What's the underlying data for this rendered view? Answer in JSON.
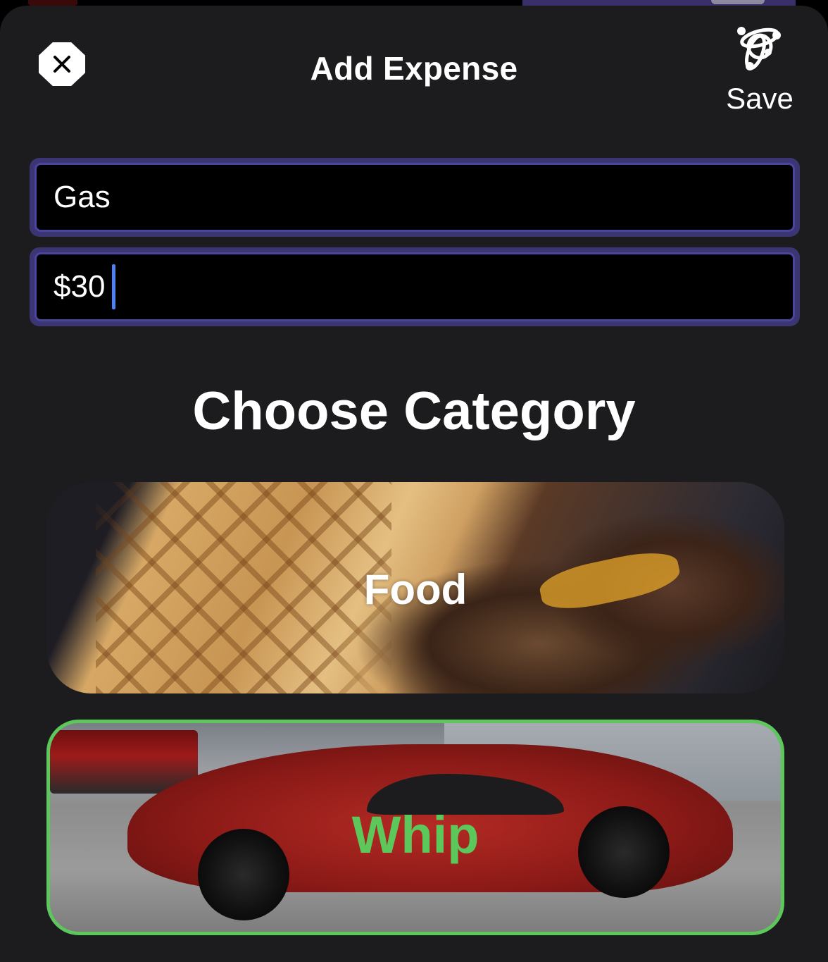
{
  "header": {
    "title": "Add Expense",
    "close_icon": "close-icon",
    "save_icon": "cluster-logo-icon",
    "save_label": "Save"
  },
  "form": {
    "name_value": "Gas",
    "amount_value": "$30"
  },
  "categories": {
    "title": "Choose Category",
    "items": [
      {
        "label": "Food",
        "selected": false
      },
      {
        "label": "Whip",
        "selected": true
      }
    ]
  },
  "colors": {
    "background": "#1c1c1e",
    "field_border": "#3c3574",
    "caret": "#4d82f3",
    "selected_accent": "#5cc75a"
  }
}
